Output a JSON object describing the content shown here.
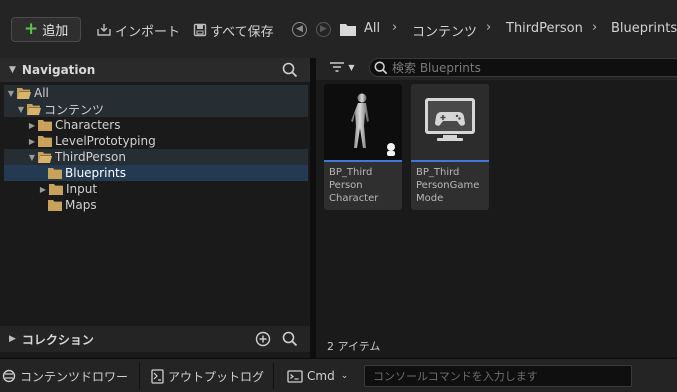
{
  "toolbar": {
    "add_label": "追加",
    "import_label": "インポート",
    "save_all_label": "すべて保存",
    "breadcrumbs": [
      "All",
      "コンテンツ",
      "ThirdPerson",
      "Blueprints"
    ]
  },
  "navigation": {
    "title": "Navigation",
    "tree": [
      {
        "label": "All"
      },
      {
        "label": "コンテンツ"
      },
      {
        "label": "Characters"
      },
      {
        "label": "LevelPrototyping"
      },
      {
        "label": "ThirdPerson"
      },
      {
        "label": "Blueprints"
      },
      {
        "label": "Input"
      },
      {
        "label": "Maps"
      }
    ]
  },
  "collections": {
    "title": "コレクション"
  },
  "content": {
    "search_placeholder": "検索 Blueprints",
    "items": [
      {
        "lines": [
          "BP_Third",
          "Person",
          "Character"
        ],
        "icon": "character-icon"
      },
      {
        "lines": [
          "BP_Third",
          "PersonGame",
          "Mode"
        ],
        "icon": "gamepad-monitor-icon"
      }
    ],
    "count_label": "2 アイテム"
  },
  "statusbar": {
    "content_drawer_label": "コンテンツドロワー",
    "output_log_label": "アウトプットログ",
    "cmd_label": "Cmd",
    "console_placeholder": "コンソールコマンドを入力します"
  },
  "colors": {
    "accent": "#3e78d8",
    "folder": "#c8a25a",
    "selection": "#243a52",
    "add_plus": "#5fc24a"
  }
}
